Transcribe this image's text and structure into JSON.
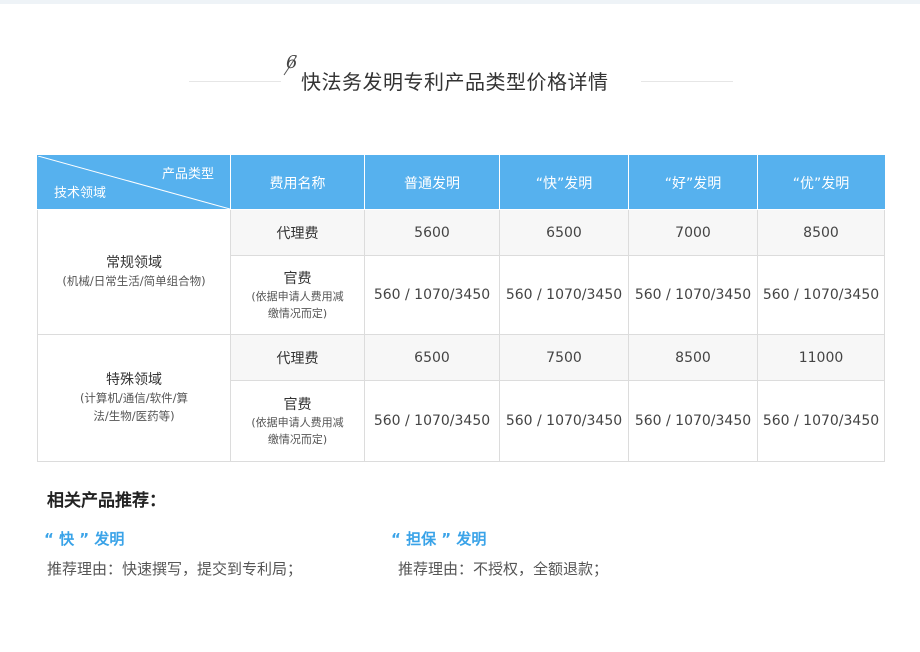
{
  "title": {
    "number": "6",
    "text": "快法务发明专利产品类型价格详情"
  },
  "table": {
    "corner_top": "产品类型",
    "corner_bottom": "技术领域",
    "headers": [
      "费用名称",
      "普通发明",
      "“快”发明",
      "“好”发明",
      "“优”发明"
    ],
    "groups": [
      {
        "domain": "常规领域",
        "domain_sub": "(机械/日常生活/简单组合物)",
        "agent_fee_label": "代理费",
        "agent_fees": [
          "5600",
          "6500",
          "7000",
          "8500"
        ],
        "official_fee_label": "官费",
        "official_fee_note": "(依据申请人费用减缴情况而定)",
        "official_fees": [
          "560 / 1070/3450",
          "560 / 1070/3450",
          "560 / 1070/3450",
          "560 / 1070/3450"
        ]
      },
      {
        "domain": "特殊领域",
        "domain_sub": "(计算机/通信/软件/算法/生物/医药等)",
        "agent_fee_label": "代理费",
        "agent_fees": [
          "6500",
          "7500",
          "8500",
          "11000"
        ],
        "official_fee_label": "官费",
        "official_fee_note": "(依据申请人费用减缴情况而定)",
        "official_fees": [
          "560 / 1070/3450",
          "560 / 1070/3450",
          "560 / 1070/3450",
          "560 / 1070/3450"
        ]
      }
    ]
  },
  "recommend": {
    "heading": "相关产品推荐：",
    "items": [
      {
        "name": "“ 快 ” 发明",
        "reason": "推荐理由：快速撰写，提交到专利局；"
      },
      {
        "name": "“ 担保 ” 发明",
        "reason": "推荐理由：不授权，全额退款；"
      }
    ]
  },
  "colors": {
    "header_bg": "#56b1ee",
    "accent_text": "#3aa3e8",
    "stripe_bg": "#f7f7f7"
  }
}
